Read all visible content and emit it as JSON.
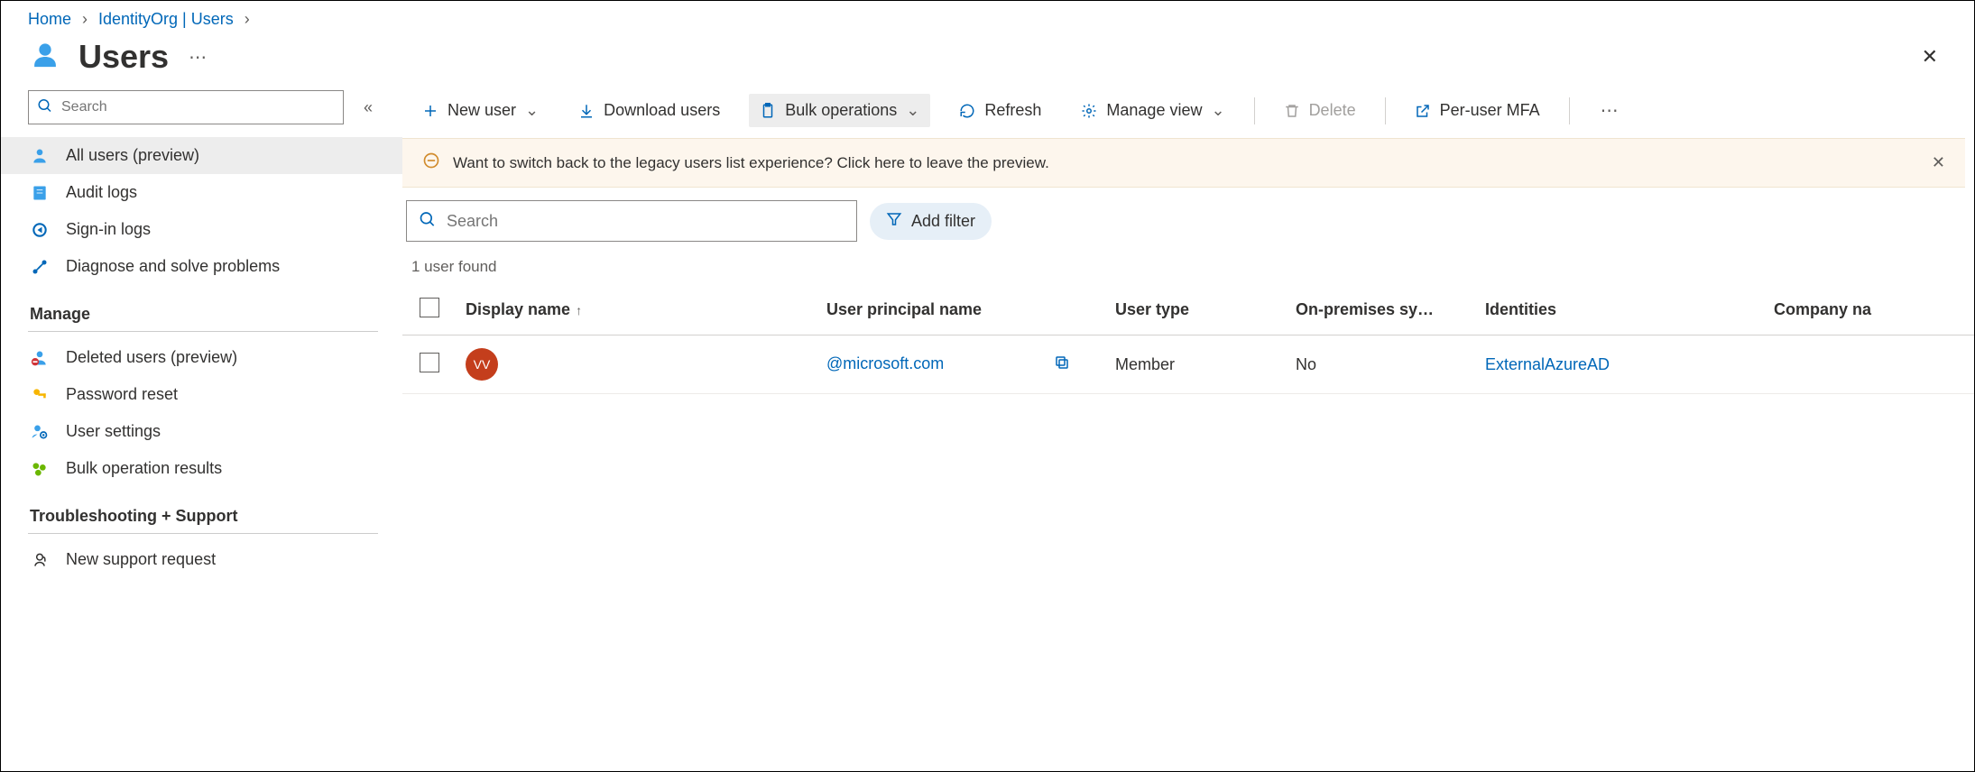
{
  "breadcrumb": {
    "home": "Home",
    "org": "IdentityOrg | Users"
  },
  "page": {
    "title": "Users"
  },
  "sidebar": {
    "search_placeholder": "Search",
    "items": [
      {
        "label": "All users (preview)"
      },
      {
        "label": "Audit logs"
      },
      {
        "label": "Sign-in logs"
      },
      {
        "label": "Diagnose and solve problems"
      }
    ],
    "group_manage": "Manage",
    "manage_items": [
      {
        "label": "Deleted users (preview)"
      },
      {
        "label": "Password reset"
      },
      {
        "label": "User settings"
      },
      {
        "label": "Bulk operation results"
      }
    ],
    "group_troubleshoot": "Troubleshooting + Support",
    "troubleshoot_items": [
      {
        "label": "New support request"
      }
    ]
  },
  "toolbar": {
    "new_user": "New user",
    "download": "Download users",
    "bulk": "Bulk operations",
    "refresh": "Refresh",
    "manage_view": "Manage view",
    "delete": "Delete",
    "mfa": "Per-user MFA"
  },
  "banner": {
    "text": "Want to switch back to the legacy users list experience? Click here to leave the preview."
  },
  "filter": {
    "search_placeholder": "Search",
    "add_filter": "Add filter"
  },
  "table": {
    "count_text": "1 user found",
    "cols": {
      "display_name": "Display name",
      "upn": "User principal name",
      "user_type": "User type",
      "on_prem": "On-premises sy…",
      "identities": "Identities",
      "company": "Company na"
    },
    "rows": [
      {
        "avatar": "VV",
        "display_name": "",
        "upn": "@microsoft.com",
        "user_type": "Member",
        "on_prem": "No",
        "identities": "ExternalAzureAD",
        "company": ""
      }
    ]
  }
}
